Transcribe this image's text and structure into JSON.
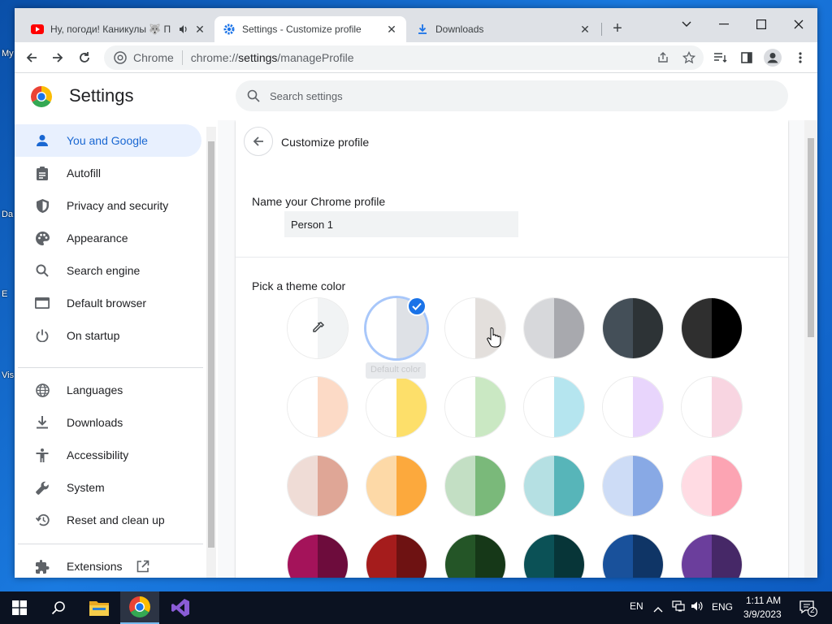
{
  "desktop": {
    "labels": [
      "My",
      "Da",
      "E",
      "Vis"
    ]
  },
  "tabs": [
    {
      "title": "Ну, погоди! Каникулы 🐺 П",
      "icon": "youtube-icon",
      "active": false
    },
    {
      "title": "Settings - Customize profile",
      "icon": "settings-gear-icon",
      "active": true
    },
    {
      "title": "Downloads",
      "icon": "download-icon",
      "active": false
    }
  ],
  "omnibox": {
    "site_label": "Chrome",
    "url_scheme": "chrome://",
    "url_host": "settings",
    "url_path": "/manageProfile"
  },
  "settings": {
    "title": "Settings",
    "search_placeholder": "Search settings"
  },
  "sidebar": {
    "items": [
      {
        "label": "You and Google",
        "icon": "person-icon",
        "active": true
      },
      {
        "label": "Autofill",
        "icon": "clipboard-icon"
      },
      {
        "label": "Privacy and security",
        "icon": "shield-icon"
      },
      {
        "label": "Appearance",
        "icon": "palette-icon"
      },
      {
        "label": "Search engine",
        "icon": "search-icon"
      },
      {
        "label": "Default browser",
        "icon": "browser-icon"
      },
      {
        "label": "On startup",
        "icon": "power-icon"
      },
      {
        "label": "Languages",
        "icon": "globe-icon"
      },
      {
        "label": "Downloads",
        "icon": "download-icon"
      },
      {
        "label": "Accessibility",
        "icon": "accessibility-icon"
      },
      {
        "label": "System",
        "icon": "wrench-icon"
      },
      {
        "label": "Reset and clean up",
        "icon": "reset-icon"
      },
      {
        "label": "Extensions",
        "icon": "puzzle-icon"
      }
    ]
  },
  "profile": {
    "page_title": "Customize profile",
    "name_label": "Name your Chrome profile",
    "name_value": "Person 1",
    "theme_label": "Pick a theme color",
    "tooltip": "Default color"
  },
  "theme_colors": [
    {
      "l": "#ffffff",
      "r": "#f1f3f4",
      "type": "custom"
    },
    {
      "l": "#ffffff",
      "r": "#dee1e6",
      "selected": true
    },
    {
      "l": "#ffffff",
      "r": "#e3dfdc"
    },
    {
      "l": "#d7d8db",
      "r": "#a8a9ae"
    },
    {
      "l": "#444f58",
      "r": "#2d3336"
    },
    {
      "l": "#2f2f2f",
      "r": "#000000"
    },
    {
      "l": "#ffffff",
      "r": "#fcdac6"
    },
    {
      "l": "#ffffff",
      "r": "#fddf6a"
    },
    {
      "l": "#ffffff",
      "r": "#cae8c3"
    },
    {
      "l": "#ffffff",
      "r": "#b5e5ef"
    },
    {
      "l": "#ffffff",
      "r": "#e8d5fc"
    },
    {
      "l": "#ffffff",
      "r": "#f8d5e1"
    },
    {
      "l": "#efdcd6",
      "r": "#dfa696"
    },
    {
      "l": "#fdd9a7",
      "r": "#fca93d"
    },
    {
      "l": "#c3dfc4",
      "r": "#7ab97a"
    },
    {
      "l": "#b5e0e3",
      "r": "#57b5b9"
    },
    {
      "l": "#cddcf6",
      "r": "#88a9e5"
    },
    {
      "l": "#ffdbe3",
      "r": "#fca4b3"
    },
    {
      "l": "#a4135a",
      "r": "#6d0c3c"
    },
    {
      "l": "#a51c1c",
      "r": "#6e1212"
    },
    {
      "l": "#245527",
      "r": "#163818"
    },
    {
      "l": "#0b5156",
      "r": "#073538"
    },
    {
      "l": "#19519b",
      "r": "#0f3566"
    },
    {
      "l": "#6b3e9c",
      "r": "#462867"
    }
  ],
  "taskbar": {
    "language": "EN",
    "input": "ENG",
    "time": "1:11 AM",
    "date": "3/9/2023",
    "notifications": "2"
  }
}
